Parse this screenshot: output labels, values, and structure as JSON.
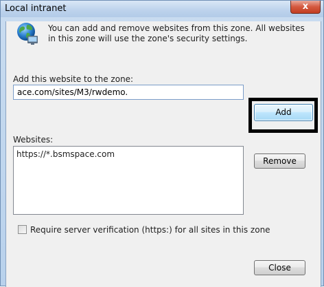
{
  "window": {
    "title": "Local intranet",
    "close_glyph": "x"
  },
  "intro": {
    "icon": "globe-zone-icon",
    "text": "You can add and remove websites from this zone. All websites in this zone will use the zone's security settings."
  },
  "add_section": {
    "label": "Add this website to the zone:",
    "input_value": "ace.com/sites/M3/rwdemo.",
    "add_button": "Add"
  },
  "websites_section": {
    "label": "Websites:",
    "items": [
      "https://*.bsmspace.com"
    ],
    "remove_button": "Remove"
  },
  "verification": {
    "checked": false,
    "label": "Require server verification (https:) for all sites in this zone"
  },
  "footer": {
    "close_button": "Close"
  },
  "colors": {
    "title_bar": "#bcd2ec",
    "close_button": "#c23d22",
    "highlight": "#000000",
    "add_button_border": "#3c7fb1"
  }
}
